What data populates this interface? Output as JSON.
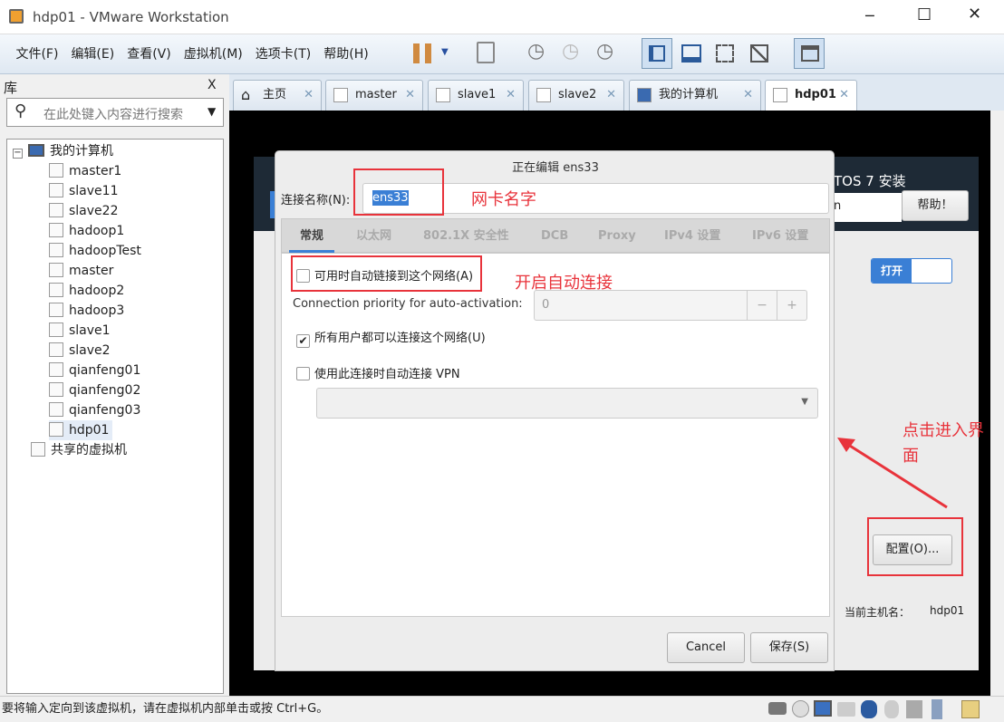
{
  "window": {
    "title": "hdp01 - VMware Workstation"
  },
  "menu": [
    "文件(F)",
    "编辑(E)",
    "查看(V)",
    "虚拟机(M)",
    "选项卡(T)",
    "帮助(H)"
  ],
  "toolbar_icons": [
    "pause-icon",
    "dropdown-icon",
    "send-ctrl-alt-del-icon",
    "snapshot-take-icon",
    "snapshot-revert-icon",
    "snapshot-manager-icon",
    "sidebar-view-icon",
    "console-view-icon",
    "fullscreen-icon",
    "unity-icon",
    "thumbnail-icon"
  ],
  "library": {
    "title": "库",
    "close": "X",
    "search_placeholder": "在此处键入内容进行搜索",
    "root": "我的计算机",
    "vms": [
      "master1",
      "slave11",
      "slave22",
      "hadoop1",
      "hadoopTest",
      "master",
      "hadoop2",
      "hadoop3",
      "slave1",
      "slave2",
      "qianfeng01",
      "qianfeng02",
      "qianfeng03",
      "hdp01"
    ],
    "shared": "共享的虚拟机"
  },
  "tabs": [
    {
      "label": "主页"
    },
    {
      "label": "master"
    },
    {
      "label": "slave1"
    },
    {
      "label": "slave2"
    },
    {
      "label": "我的计算机"
    },
    {
      "label": "hdp01",
      "active": true
    }
  ],
  "installer": {
    "header_right": "TOS 7 安装",
    "help": "帮助！",
    "field_partial": "n",
    "toggle": "打开",
    "config": "配置(O)...",
    "hostname_label": "当前主机名：",
    "hostname": "hdp01"
  },
  "dialog": {
    "title": "正在编辑 ens33",
    "name_label": "连接名称(N):",
    "name_value": "ens33",
    "tabs": [
      "常规",
      "以太网",
      "802.1X 安全性",
      "DCB",
      "Proxy",
      "IPv4 设置",
      "IPv6 设置"
    ],
    "auto_connect": {
      "label": "可用时自动链接到这个网络(A)",
      "checked": false
    },
    "priority_label": "Connection priority for auto-activation:",
    "priority_value": "0",
    "all_users": {
      "label": "所有用户都可以连接这个网络(U)",
      "checked": true
    },
    "vpn": {
      "label": "使用此连接时自动连接 VPN",
      "checked": false
    },
    "cancel": "Cancel",
    "save": "保存(S)"
  },
  "annotations": {
    "nic_name": "网卡名字",
    "auto_connect": "开启自动连接",
    "click_enter": "点击进入界面"
  },
  "status": {
    "text": "要将输入定向到该虚拟机，请在虚拟机内部单击或按 Ctrl+G。"
  },
  "colors": {
    "annotation": "#e8333b",
    "accent": "#3a7fd5"
  }
}
